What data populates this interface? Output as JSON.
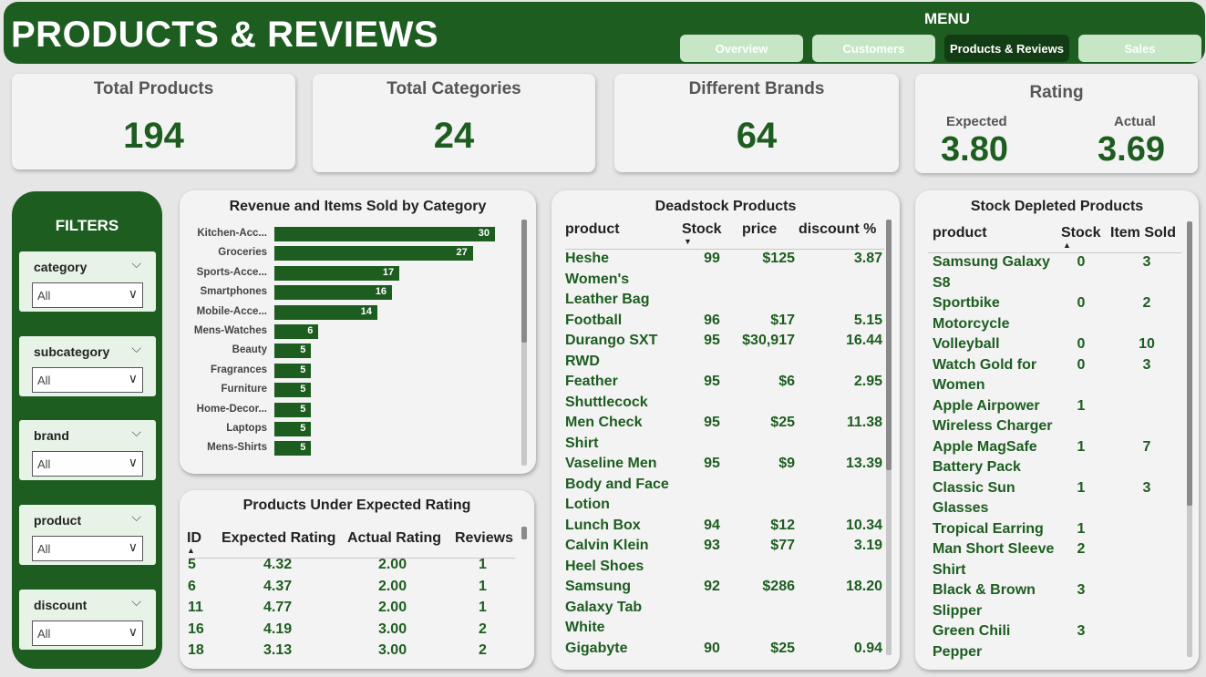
{
  "header": {
    "title": "PRODUCTS & REVIEWS",
    "menu_label": "MENU",
    "menu": [
      "Overview",
      "Customers",
      "Products & Reviews",
      "Sales"
    ]
  },
  "kpis": {
    "total_products": {
      "label": "Total Products",
      "value": "194"
    },
    "total_categories": {
      "label": "Total Categories",
      "value": "24"
    },
    "different_brands": {
      "label": "Different Brands",
      "value": "64"
    },
    "rating": {
      "label": "Rating",
      "expected_label": "Expected",
      "expected_value": "3.80",
      "actual_label": "Actual",
      "actual_value": "3.69"
    }
  },
  "filters": {
    "title": "FILTERS",
    "slicers": [
      {
        "label": "category",
        "value": "All"
      },
      {
        "label": "subcategory",
        "value": "All"
      },
      {
        "label": "brand",
        "value": "All"
      },
      {
        "label": "product",
        "value": "All"
      },
      {
        "label": "discount",
        "value": "All"
      }
    ]
  },
  "chart_data": {
    "type": "bar",
    "title": "Revenue and Items Sold by Category",
    "categories": [
      "Kitchen-Acc...",
      "Groceries",
      "Sports-Acce...",
      "Smartphones",
      "Mobile-Acce...",
      "Mens-Watches",
      "Beauty",
      "Fragrances",
      "Furniture",
      "Home-Decor...",
      "Laptops",
      "Mens-Shirts"
    ],
    "values": [
      30,
      27,
      17,
      16,
      14,
      6,
      5,
      5,
      5,
      5,
      5,
      5
    ],
    "xlim": [
      0,
      30
    ],
    "bar_color": "#1d5d20"
  },
  "under_rating": {
    "title": "Products Under Expected Rating",
    "columns": [
      "ID",
      "Expected Rating",
      "Actual Rating",
      "Reviews"
    ],
    "rows": [
      [
        "5",
        "4.32",
        "2.00",
        "1"
      ],
      [
        "6",
        "4.37",
        "2.00",
        "1"
      ],
      [
        "11",
        "4.77",
        "2.00",
        "1"
      ],
      [
        "16",
        "4.19",
        "3.00",
        "2"
      ],
      [
        "18",
        "3.13",
        "3.00",
        "2"
      ]
    ]
  },
  "deadstock": {
    "title": "Deadstock Products",
    "columns": [
      "product",
      "Stock",
      "price",
      "discount %"
    ],
    "rows": [
      [
        "Heshe Women's Leather Bag",
        "99",
        "$125",
        "3.87"
      ],
      [
        "Football",
        "96",
        "$17",
        "5.15"
      ],
      [
        "Durango SXT RWD",
        "95",
        "$30,917",
        "16.44"
      ],
      [
        "Feather Shuttlecock",
        "95",
        "$6",
        "2.95"
      ],
      [
        "Men Check Shirt",
        "95",
        "$25",
        "11.38"
      ],
      [
        "Vaseline Men Body and Face Lotion",
        "95",
        "$9",
        "13.39"
      ],
      [
        "Lunch Box",
        "94",
        "$12",
        "10.34"
      ],
      [
        "Calvin Klein Heel Shoes",
        "93",
        "$77",
        "3.19"
      ],
      [
        "Samsung Galaxy Tab White",
        "92",
        "$286",
        "18.20"
      ],
      [
        "Gigabyte",
        "90",
        "$25",
        "0.94"
      ]
    ]
  },
  "depleted": {
    "title": "Stock Depleted Products",
    "columns": [
      "product",
      "Stock",
      "Item Sold"
    ],
    "rows": [
      [
        "Samsung Galaxy S8",
        "0",
        "3"
      ],
      [
        "Sportbike Motorcycle",
        "0",
        "2"
      ],
      [
        "Volleyball",
        "0",
        "10"
      ],
      [
        "Watch Gold for Women",
        "0",
        "3"
      ],
      [
        "Apple Airpower Wireless Charger",
        "1",
        ""
      ],
      [
        "Apple MagSafe Battery Pack",
        "1",
        "7"
      ],
      [
        "Classic Sun Glasses",
        "1",
        "3"
      ],
      [
        "Tropical Earring",
        "1",
        ""
      ],
      [
        "Man Short Sleeve Shirt",
        "2",
        ""
      ],
      [
        "Black & Brown Slipper",
        "3",
        ""
      ],
      [
        "Green Chili Pepper",
        "3",
        ""
      ]
    ]
  }
}
